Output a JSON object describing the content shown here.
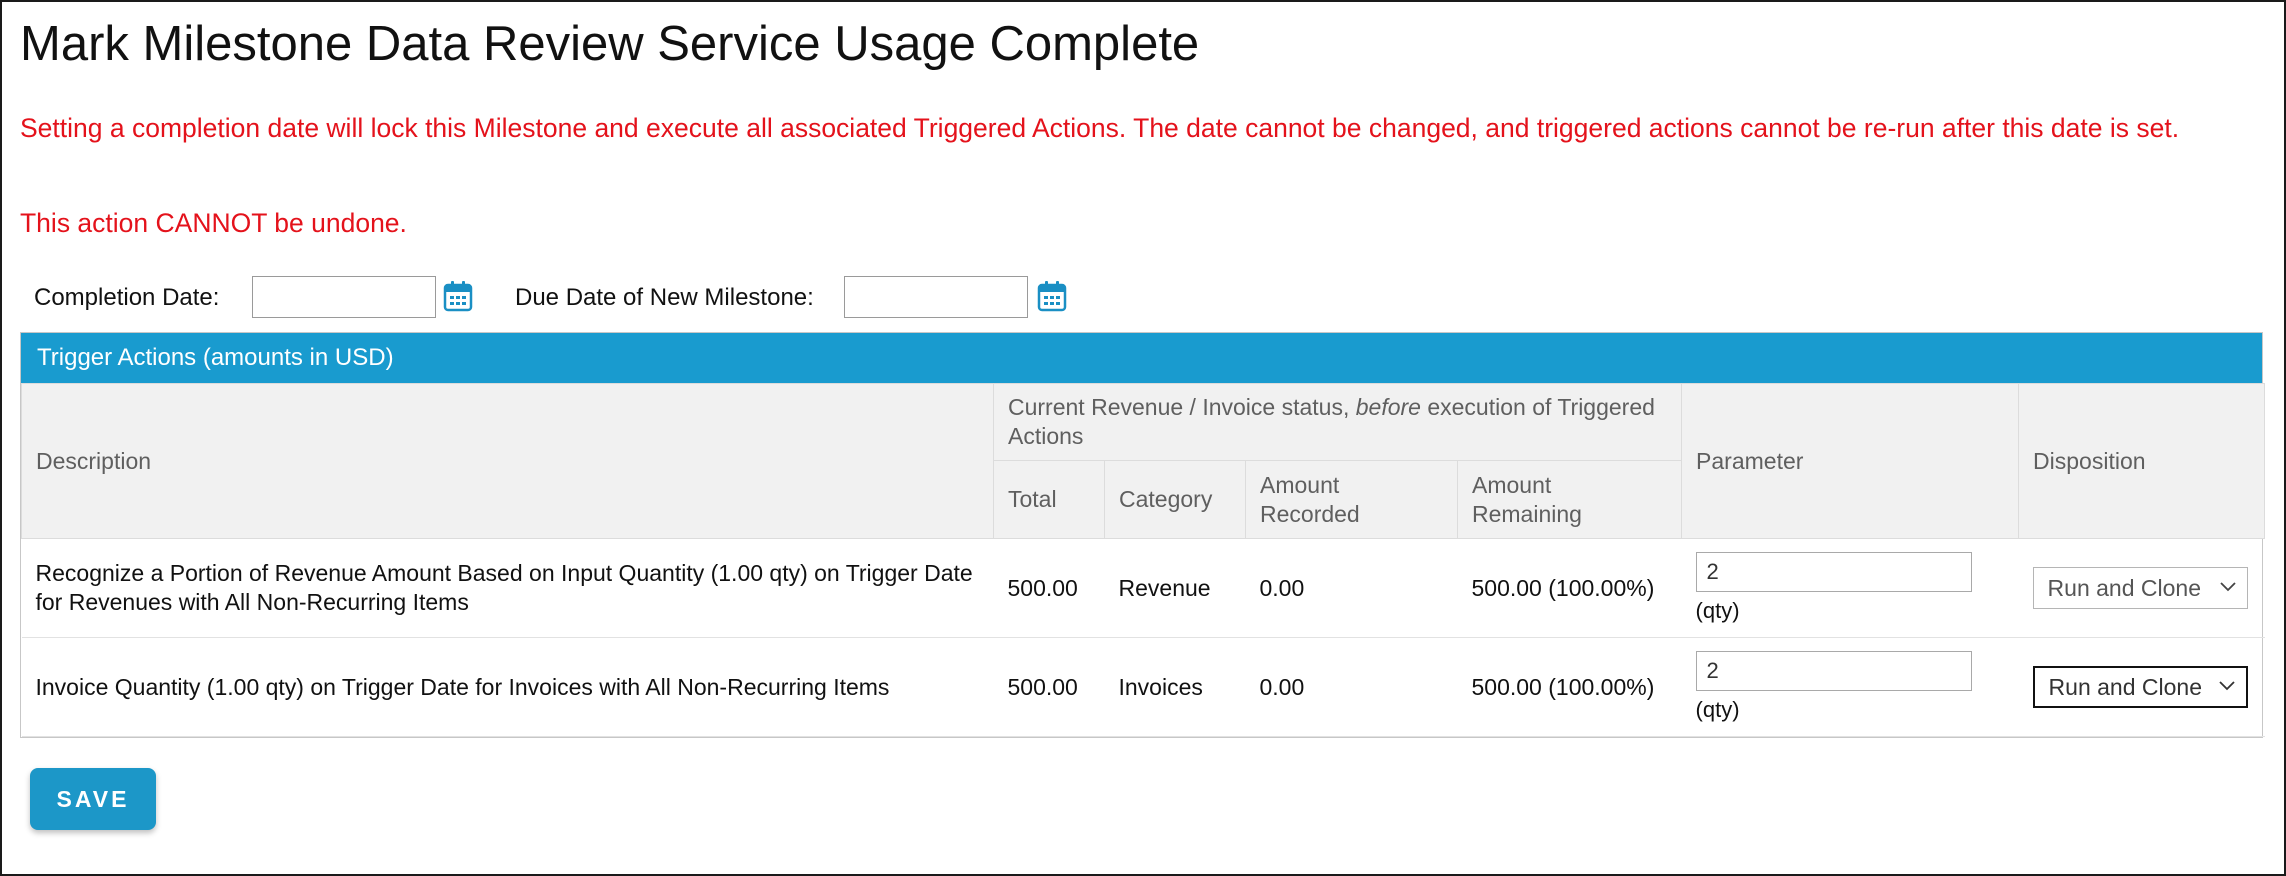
{
  "page": {
    "title": "Mark Milestone Data Review Service Usage Complete",
    "warning_1": "Setting a completion date will lock this Milestone and execute all associated Triggered Actions. The date cannot be changed, and triggered actions cannot be re-run after this date is set.",
    "warning_2": "This action CANNOT be undone."
  },
  "dates": {
    "completion_label": "Completion Date:",
    "completion_value": "",
    "due_label": "Due Date of New Milestone:",
    "due_value": ""
  },
  "panel": {
    "title": "Trigger Actions (amounts in USD)",
    "headers": {
      "description": "Description",
      "status_group_pre": "Current Revenue / Invoice status, ",
      "status_group_em": "before",
      "status_group_post": " execution of Triggered Actions",
      "total": "Total",
      "category": "Category",
      "amount_recorded": "Amount Recorded",
      "amount_remaining": "Amount Remaining",
      "parameter": "Parameter",
      "disposition": "Disposition"
    },
    "rows": [
      {
        "description": "Recognize a Portion of Revenue Amount Based on Input Quantity (1.00 qty) on Trigger Date for Revenues with All Non-Recurring Items",
        "total": "500.00",
        "category": "Revenue",
        "amount_recorded": "0.00",
        "amount_remaining": "500.00 (100.00%)",
        "parameter_value": "2",
        "parameter_unit": "(qty)",
        "disposition": "Run and Clone"
      },
      {
        "description": "Invoice Quantity (1.00 qty) on Trigger Date for Invoices with All Non-Recurring Items",
        "total": "500.00",
        "category": "Invoices",
        "amount_recorded": "0.00",
        "amount_remaining": "500.00 (100.00%)",
        "parameter_value": "2",
        "parameter_unit": "(qty)",
        "disposition": "Run and Clone"
      }
    ]
  },
  "actions": {
    "save_label": "SAVE"
  },
  "icons": {
    "calendar": "calendar-icon",
    "chevron": "chevron-down-icon"
  },
  "colors": {
    "warning": "#e4121b",
    "header_bar": "#199bcf",
    "save_button": "#1c97c8"
  }
}
